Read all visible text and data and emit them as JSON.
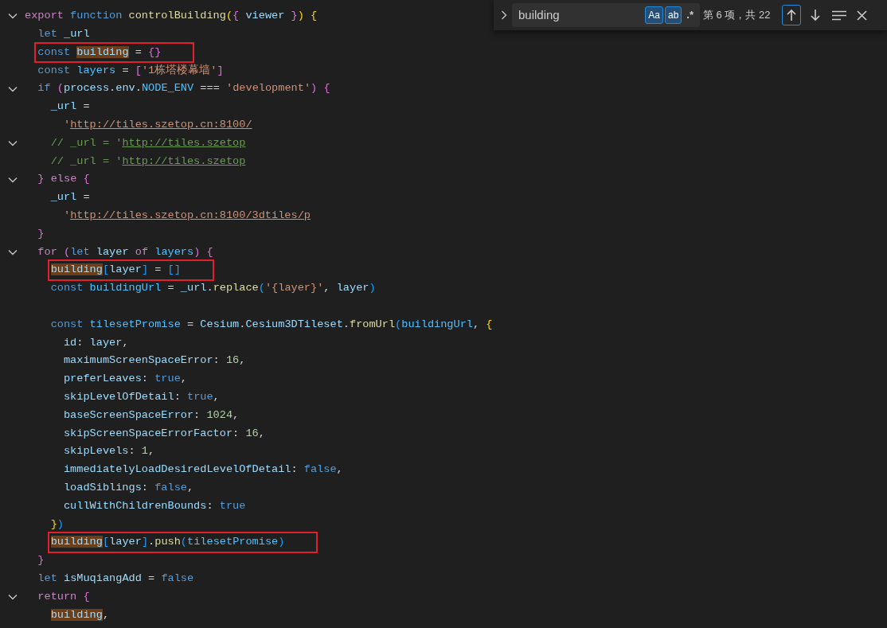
{
  "editor": {
    "lines": [
      {
        "fold": true,
        "boxed": false,
        "tokens": [
          {
            "text": "export ",
            "kind": "ctl"
          },
          {
            "text": "function ",
            "kind": "kw"
          },
          {
            "text": "controlBuilding",
            "kind": "fn"
          },
          {
            "text": "(",
            "kind": "b1"
          },
          {
            "text": "{",
            "kind": "b2"
          },
          {
            "text": " viewer ",
            "kind": "var"
          },
          {
            "text": "}",
            "kind": "b2"
          },
          {
            "text": ")",
            "kind": "b1"
          },
          {
            "text": " {",
            "kind": "b1"
          }
        ]
      },
      {
        "fold": false,
        "boxed": false,
        "tokens": [
          {
            "text": "  let ",
            "kind": "kw"
          },
          {
            "text": "_url",
            "kind": "var"
          }
        ]
      },
      {
        "fold": false,
        "boxed": true,
        "tokens": [
          {
            "text": "  const ",
            "kind": "kw"
          },
          {
            "text": "building",
            "kind": "match"
          },
          {
            "text": " = ",
            "kind": "p"
          },
          {
            "text": "{}",
            "kind": "b2"
          }
        ]
      },
      {
        "fold": false,
        "boxed": false,
        "tokens": [
          {
            "text": "  const ",
            "kind": "kw"
          },
          {
            "text": "layers",
            "kind": "const"
          },
          {
            "text": " = ",
            "kind": "p"
          },
          {
            "text": "[",
            "kind": "b2"
          },
          {
            "text": "'1栋塔楼幕墙'",
            "kind": "str"
          },
          {
            "text": "]",
            "kind": "b2"
          }
        ]
      },
      {
        "fold": true,
        "boxed": false,
        "tokens": [
          {
            "text": "  if ",
            "kind": "kw"
          },
          {
            "text": "(",
            "kind": "b2"
          },
          {
            "text": "process",
            "kind": "var"
          },
          {
            "text": ".",
            "kind": "p"
          },
          {
            "text": "env",
            "kind": "var"
          },
          {
            "text": ".",
            "kind": "p"
          },
          {
            "text": "NODE_ENV",
            "kind": "const"
          },
          {
            "text": " === ",
            "kind": "p"
          },
          {
            "text": "'development'",
            "kind": "str"
          },
          {
            "text": ")",
            "kind": "b2"
          },
          {
            "text": " {",
            "kind": "b2"
          }
        ]
      },
      {
        "fold": false,
        "boxed": false,
        "tokens": [
          {
            "text": "    _url",
            "kind": "var"
          },
          {
            "text": " =",
            "kind": "p"
          }
        ]
      },
      {
        "fold": false,
        "boxed": false,
        "tokens": [
          {
            "text": "      '",
            "kind": "str"
          },
          {
            "text": "http://tiles.szetop.cn:8100/",
            "kind": "url"
          }
        ]
      },
      {
        "fold": true,
        "boxed": false,
        "tokens": [
          {
            "text": "    // _url = '",
            "kind": "cmt"
          },
          {
            "text": "http://tiles.szetop",
            "kind": "cmturl"
          }
        ]
      },
      {
        "fold": false,
        "boxed": false,
        "tokens": [
          {
            "text": "    // _url = '",
            "kind": "cmt"
          },
          {
            "text": "http://tiles.szetop",
            "kind": "cmturl"
          }
        ]
      },
      {
        "fold": true,
        "boxed": false,
        "tokens": [
          {
            "text": "  }",
            "kind": "b2"
          },
          {
            "text": " else ",
            "kind": "ctl"
          },
          {
            "text": "{",
            "kind": "b2"
          }
        ]
      },
      {
        "fold": false,
        "boxed": false,
        "tokens": [
          {
            "text": "    _url",
            "kind": "var"
          },
          {
            "text": " =",
            "kind": "p"
          }
        ]
      },
      {
        "fold": false,
        "boxed": false,
        "tokens": [
          {
            "text": "      '",
            "kind": "str"
          },
          {
            "text": "http://tiles.szetop.cn:8100/3dtiles/p",
            "kind": "url"
          }
        ]
      },
      {
        "fold": false,
        "boxed": false,
        "tokens": [
          {
            "text": "  }",
            "kind": "b2"
          }
        ]
      },
      {
        "fold": true,
        "boxed": false,
        "tokens": [
          {
            "text": "  for ",
            "kind": "ctl"
          },
          {
            "text": "(",
            "kind": "b2"
          },
          {
            "text": "let ",
            "kind": "kw"
          },
          {
            "text": "layer ",
            "kind": "var"
          },
          {
            "text": "of ",
            "kind": "ctl"
          },
          {
            "text": "layers",
            "kind": "const"
          },
          {
            "text": ")",
            "kind": "b2"
          },
          {
            "text": " {",
            "kind": "b2"
          }
        ]
      },
      {
        "fold": false,
        "boxed": true,
        "tokens": [
          {
            "text": "    building",
            "kind": "match"
          },
          {
            "text": "[",
            "kind": "b3"
          },
          {
            "text": "layer",
            "kind": "var"
          },
          {
            "text": "]",
            "kind": "b3"
          },
          {
            "text": " = ",
            "kind": "p"
          },
          {
            "text": "[]",
            "kind": "b3"
          }
        ]
      },
      {
        "fold": false,
        "boxed": false,
        "tokens": [
          {
            "text": "    const ",
            "kind": "kw"
          },
          {
            "text": "buildingUrl",
            "kind": "const"
          },
          {
            "text": " = ",
            "kind": "p"
          },
          {
            "text": "_url",
            "kind": "var"
          },
          {
            "text": ".",
            "kind": "p"
          },
          {
            "text": "replace",
            "kind": "fn"
          },
          {
            "text": "(",
            "kind": "b3"
          },
          {
            "text": "'{layer}'",
            "kind": "str"
          },
          {
            "text": ", ",
            "kind": "p"
          },
          {
            "text": "layer",
            "kind": "var"
          },
          {
            "text": ")",
            "kind": "b3"
          }
        ]
      },
      {
        "fold": false,
        "boxed": false
      },
      {
        "fold": false,
        "boxed": false,
        "tokens": [
          {
            "text": "    const ",
            "kind": "kw"
          },
          {
            "text": "tilesetPromise",
            "kind": "const"
          },
          {
            "text": " = ",
            "kind": "p"
          },
          {
            "text": "Cesium",
            "kind": "var"
          },
          {
            "text": ".",
            "kind": "p"
          },
          {
            "text": "Cesium3DTileset",
            "kind": "var"
          },
          {
            "text": ".",
            "kind": "p"
          },
          {
            "text": "fromUrl",
            "kind": "fn"
          },
          {
            "text": "(",
            "kind": "b3"
          },
          {
            "text": "buildingUrl",
            "kind": "const"
          },
          {
            "text": ", ",
            "kind": "p"
          },
          {
            "text": "{",
            "kind": "b1"
          }
        ]
      },
      {
        "fold": false,
        "boxed": false,
        "tokens": [
          {
            "text": "      id",
            "kind": "var"
          },
          {
            "text": ": ",
            "kind": "p"
          },
          {
            "text": "layer",
            "kind": "var"
          },
          {
            "text": ",",
            "kind": "p"
          }
        ]
      },
      {
        "fold": false,
        "boxed": false,
        "tokens": [
          {
            "text": "      maximumScreenSpaceError",
            "kind": "var"
          },
          {
            "text": ": ",
            "kind": "p"
          },
          {
            "text": "16",
            "kind": "num"
          },
          {
            "text": ",",
            "kind": "p"
          }
        ]
      },
      {
        "fold": false,
        "boxed": false,
        "tokens": [
          {
            "text": "      preferLeaves",
            "kind": "var"
          },
          {
            "text": ": ",
            "kind": "p"
          },
          {
            "text": "true",
            "kind": "kw"
          },
          {
            "text": ",",
            "kind": "p"
          }
        ]
      },
      {
        "fold": false,
        "boxed": false,
        "tokens": [
          {
            "text": "      skipLevelOfDetail",
            "kind": "var"
          },
          {
            "text": ": ",
            "kind": "p"
          },
          {
            "text": "true",
            "kind": "kw"
          },
          {
            "text": ",",
            "kind": "p"
          }
        ]
      },
      {
        "fold": false,
        "boxed": false,
        "tokens": [
          {
            "text": "      baseScreenSpaceError",
            "kind": "var"
          },
          {
            "text": ": ",
            "kind": "p"
          },
          {
            "text": "1024",
            "kind": "num"
          },
          {
            "text": ",",
            "kind": "p"
          }
        ]
      },
      {
        "fold": false,
        "boxed": false,
        "tokens": [
          {
            "text": "      skipScreenSpaceErrorFactor",
            "kind": "var"
          },
          {
            "text": ": ",
            "kind": "p"
          },
          {
            "text": "16",
            "kind": "num"
          },
          {
            "text": ",",
            "kind": "p"
          }
        ]
      },
      {
        "fold": false,
        "boxed": false,
        "tokens": [
          {
            "text": "      skipLevels",
            "kind": "var"
          },
          {
            "text": ": ",
            "kind": "p"
          },
          {
            "text": "1",
            "kind": "num"
          },
          {
            "text": ",",
            "kind": "p"
          }
        ]
      },
      {
        "fold": false,
        "boxed": false,
        "tokens": [
          {
            "text": "      immediatelyLoadDesiredLevelOfDetail",
            "kind": "var"
          },
          {
            "text": ": ",
            "kind": "p"
          },
          {
            "text": "false",
            "kind": "kw"
          },
          {
            "text": ",",
            "kind": "p"
          }
        ]
      },
      {
        "fold": false,
        "boxed": false,
        "tokens": [
          {
            "text": "      loadSiblings",
            "kind": "var"
          },
          {
            "text": ": ",
            "kind": "p"
          },
          {
            "text": "false",
            "kind": "kw"
          },
          {
            "text": ",",
            "kind": "p"
          }
        ]
      },
      {
        "fold": false,
        "boxed": false,
        "tokens": [
          {
            "text": "      cullWithChildrenBounds",
            "kind": "var"
          },
          {
            "text": ": ",
            "kind": "p"
          },
          {
            "text": "true",
            "kind": "kw"
          }
        ]
      },
      {
        "fold": false,
        "boxed": false,
        "tokens": [
          {
            "text": "    }",
            "kind": "b1"
          },
          {
            "text": ")",
            "kind": "b3"
          }
        ]
      },
      {
        "fold": false,
        "boxed": true,
        "tokens": [
          {
            "text": "    building",
            "kind": "match"
          },
          {
            "text": "[",
            "kind": "b3"
          },
          {
            "text": "layer",
            "kind": "var"
          },
          {
            "text": "]",
            "kind": "b3"
          },
          {
            "text": ".",
            "kind": "p"
          },
          {
            "text": "push",
            "kind": "fn"
          },
          {
            "text": "(",
            "kind": "b3"
          },
          {
            "text": "tilesetPromise",
            "kind": "const"
          },
          {
            "text": ")",
            "kind": "b3"
          }
        ]
      },
      {
        "fold": false,
        "boxed": false,
        "tokens": [
          {
            "text": "  }",
            "kind": "b2"
          }
        ]
      },
      {
        "fold": false,
        "boxed": false,
        "tokens": [
          {
            "text": "  let ",
            "kind": "kw"
          },
          {
            "text": "isMuqiangAdd",
            "kind": "var"
          },
          {
            "text": " = ",
            "kind": "p"
          },
          {
            "text": "false",
            "kind": "kw"
          }
        ]
      },
      {
        "fold": true,
        "boxed": false,
        "tokens": [
          {
            "text": "  return ",
            "kind": "ctl"
          },
          {
            "text": "{",
            "kind": "b2"
          }
        ]
      },
      {
        "fold": false,
        "boxed": false,
        "tokens": [
          {
            "text": "    building",
            "kind": "match"
          },
          {
            "text": ",",
            "kind": "p"
          }
        ]
      }
    ]
  },
  "find_widget": {
    "query": "building",
    "options": [
      {
        "label": "Aa",
        "selected": true
      },
      {
        "label": "ab",
        "selected": true
      },
      {
        "label": ".*",
        "selected": false
      }
    ],
    "result": "第 6 项，共 22"
  }
}
